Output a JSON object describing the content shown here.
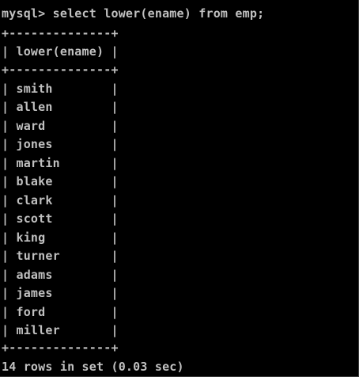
{
  "terminal": {
    "command_line": "mysql> select lower(ename) from emp;",
    "table": {
      "border_line": "+--------------+",
      "header_row": "| lower(ename) |",
      "rows": [
        "| smith        |",
        "| allen        |",
        "| ward         |",
        "| jones        |",
        "| martin       |",
        "| blake        |",
        "| clark        |",
        "| scott        |",
        "| king         |",
        "| turner       |",
        "| adams        |",
        "| james        |",
        "| ford         |",
        "| miller       |"
      ]
    },
    "status_line": "14 rows in set (0.03 sec)"
  },
  "colors": {
    "background": "#000000",
    "text": "#c0c0c0"
  }
}
